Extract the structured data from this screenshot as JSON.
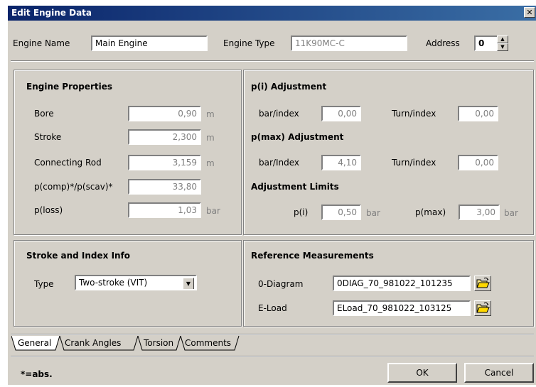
{
  "window": {
    "title": "Edit Engine Data",
    "close": "✕"
  },
  "header": {
    "engine_name_label": "Engine Name",
    "engine_name_value": "Main Engine",
    "engine_type_label": "Engine Type",
    "engine_type_value": "11K90MC-C",
    "address_label": "Address",
    "address_value": "0"
  },
  "engine_properties": {
    "title": "Engine Properties",
    "rows": [
      {
        "label": "Bore",
        "value": "0,90",
        "unit": "m"
      },
      {
        "label": "Stroke",
        "value": "2,300",
        "unit": "m"
      },
      {
        "label": "Connecting Rod",
        "value": "3,159",
        "unit": "m"
      },
      {
        "label": "p(comp)*/p(scav)*",
        "value": "33,80",
        "unit": ""
      },
      {
        "label": "p(loss)",
        "value": "1,03",
        "unit": "bar"
      }
    ]
  },
  "pi_adjustment": {
    "title": "p(i) Adjustment",
    "bar_label": "bar/index",
    "bar_value": "0,00",
    "turn_label": "Turn/index",
    "turn_value": "0,00"
  },
  "pmax_adjustment": {
    "title": "p(max) Adjustment",
    "bar_label": "bar/Index",
    "bar_value": "4,10",
    "turn_label": "Turn/index",
    "turn_value": "0,00"
  },
  "adjustment_limits": {
    "title": "Adjustment Limits",
    "pi_label": "p(i)",
    "pi_value": "0,50",
    "pi_unit": "bar",
    "pmax_label": "p(max)",
    "pmax_value": "3,00",
    "pmax_unit": "bar"
  },
  "stroke_index": {
    "title": "Stroke and Index Info",
    "type_label": "Type",
    "type_value": "Two-stroke (VIT)"
  },
  "reference": {
    "title": "Reference Measurements",
    "odiagram_label": "0-Diagram",
    "odiagram_value": "0DIAG_70_981022_101235",
    "eload_label": "E-Load",
    "eload_value": "ELoad_70_981022_103125"
  },
  "tabs": [
    "General",
    "Crank Angles",
    "Torsion",
    "Comments"
  ],
  "footer": {
    "note": "*=abs.",
    "ok": "OK",
    "cancel": "Cancel"
  }
}
